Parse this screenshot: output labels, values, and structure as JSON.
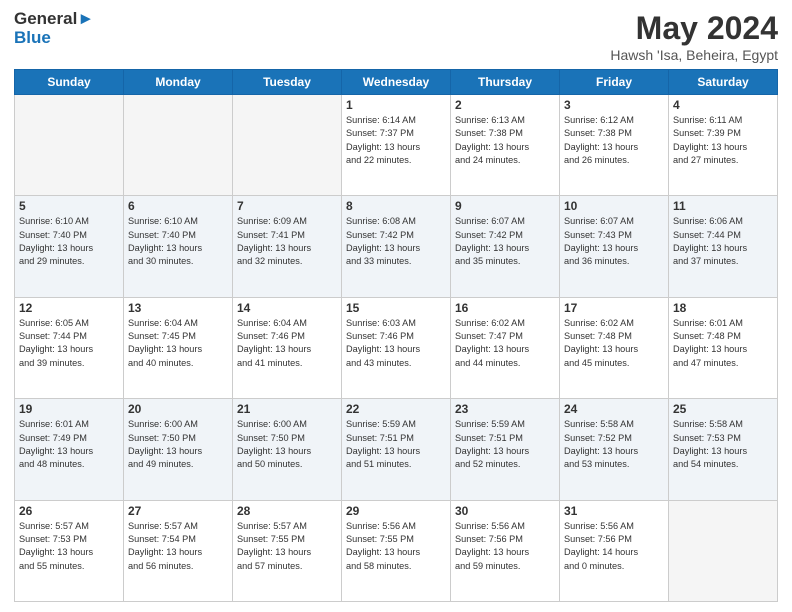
{
  "header": {
    "logo_line1": "General",
    "logo_line2": "Blue",
    "month": "May 2024",
    "location": "Hawsh 'Isa, Beheira, Egypt"
  },
  "weekdays": [
    "Sunday",
    "Monday",
    "Tuesday",
    "Wednesday",
    "Thursday",
    "Friday",
    "Saturday"
  ],
  "weeks": [
    [
      {
        "day": "",
        "info": ""
      },
      {
        "day": "",
        "info": ""
      },
      {
        "day": "",
        "info": ""
      },
      {
        "day": "1",
        "info": "Sunrise: 6:14 AM\nSunset: 7:37 PM\nDaylight: 13 hours\nand 22 minutes."
      },
      {
        "day": "2",
        "info": "Sunrise: 6:13 AM\nSunset: 7:38 PM\nDaylight: 13 hours\nand 24 minutes."
      },
      {
        "day": "3",
        "info": "Sunrise: 6:12 AM\nSunset: 7:38 PM\nDaylight: 13 hours\nand 26 minutes."
      },
      {
        "day": "4",
        "info": "Sunrise: 6:11 AM\nSunset: 7:39 PM\nDaylight: 13 hours\nand 27 minutes."
      }
    ],
    [
      {
        "day": "5",
        "info": "Sunrise: 6:10 AM\nSunset: 7:40 PM\nDaylight: 13 hours\nand 29 minutes."
      },
      {
        "day": "6",
        "info": "Sunrise: 6:10 AM\nSunset: 7:40 PM\nDaylight: 13 hours\nand 30 minutes."
      },
      {
        "day": "7",
        "info": "Sunrise: 6:09 AM\nSunset: 7:41 PM\nDaylight: 13 hours\nand 32 minutes."
      },
      {
        "day": "8",
        "info": "Sunrise: 6:08 AM\nSunset: 7:42 PM\nDaylight: 13 hours\nand 33 minutes."
      },
      {
        "day": "9",
        "info": "Sunrise: 6:07 AM\nSunset: 7:42 PM\nDaylight: 13 hours\nand 35 minutes."
      },
      {
        "day": "10",
        "info": "Sunrise: 6:07 AM\nSunset: 7:43 PM\nDaylight: 13 hours\nand 36 minutes."
      },
      {
        "day": "11",
        "info": "Sunrise: 6:06 AM\nSunset: 7:44 PM\nDaylight: 13 hours\nand 37 minutes."
      }
    ],
    [
      {
        "day": "12",
        "info": "Sunrise: 6:05 AM\nSunset: 7:44 PM\nDaylight: 13 hours\nand 39 minutes."
      },
      {
        "day": "13",
        "info": "Sunrise: 6:04 AM\nSunset: 7:45 PM\nDaylight: 13 hours\nand 40 minutes."
      },
      {
        "day": "14",
        "info": "Sunrise: 6:04 AM\nSunset: 7:46 PM\nDaylight: 13 hours\nand 41 minutes."
      },
      {
        "day": "15",
        "info": "Sunrise: 6:03 AM\nSunset: 7:46 PM\nDaylight: 13 hours\nand 43 minutes."
      },
      {
        "day": "16",
        "info": "Sunrise: 6:02 AM\nSunset: 7:47 PM\nDaylight: 13 hours\nand 44 minutes."
      },
      {
        "day": "17",
        "info": "Sunrise: 6:02 AM\nSunset: 7:48 PM\nDaylight: 13 hours\nand 45 minutes."
      },
      {
        "day": "18",
        "info": "Sunrise: 6:01 AM\nSunset: 7:48 PM\nDaylight: 13 hours\nand 47 minutes."
      }
    ],
    [
      {
        "day": "19",
        "info": "Sunrise: 6:01 AM\nSunset: 7:49 PM\nDaylight: 13 hours\nand 48 minutes."
      },
      {
        "day": "20",
        "info": "Sunrise: 6:00 AM\nSunset: 7:50 PM\nDaylight: 13 hours\nand 49 minutes."
      },
      {
        "day": "21",
        "info": "Sunrise: 6:00 AM\nSunset: 7:50 PM\nDaylight: 13 hours\nand 50 minutes."
      },
      {
        "day": "22",
        "info": "Sunrise: 5:59 AM\nSunset: 7:51 PM\nDaylight: 13 hours\nand 51 minutes."
      },
      {
        "day": "23",
        "info": "Sunrise: 5:59 AM\nSunset: 7:51 PM\nDaylight: 13 hours\nand 52 minutes."
      },
      {
        "day": "24",
        "info": "Sunrise: 5:58 AM\nSunset: 7:52 PM\nDaylight: 13 hours\nand 53 minutes."
      },
      {
        "day": "25",
        "info": "Sunrise: 5:58 AM\nSunset: 7:53 PM\nDaylight: 13 hours\nand 54 minutes."
      }
    ],
    [
      {
        "day": "26",
        "info": "Sunrise: 5:57 AM\nSunset: 7:53 PM\nDaylight: 13 hours\nand 55 minutes."
      },
      {
        "day": "27",
        "info": "Sunrise: 5:57 AM\nSunset: 7:54 PM\nDaylight: 13 hours\nand 56 minutes."
      },
      {
        "day": "28",
        "info": "Sunrise: 5:57 AM\nSunset: 7:55 PM\nDaylight: 13 hours\nand 57 minutes."
      },
      {
        "day": "29",
        "info": "Sunrise: 5:56 AM\nSunset: 7:55 PM\nDaylight: 13 hours\nand 58 minutes."
      },
      {
        "day": "30",
        "info": "Sunrise: 5:56 AM\nSunset: 7:56 PM\nDaylight: 13 hours\nand 59 minutes."
      },
      {
        "day": "31",
        "info": "Sunrise: 5:56 AM\nSunset: 7:56 PM\nDaylight: 14 hours\nand 0 minutes."
      },
      {
        "day": "",
        "info": ""
      }
    ]
  ]
}
